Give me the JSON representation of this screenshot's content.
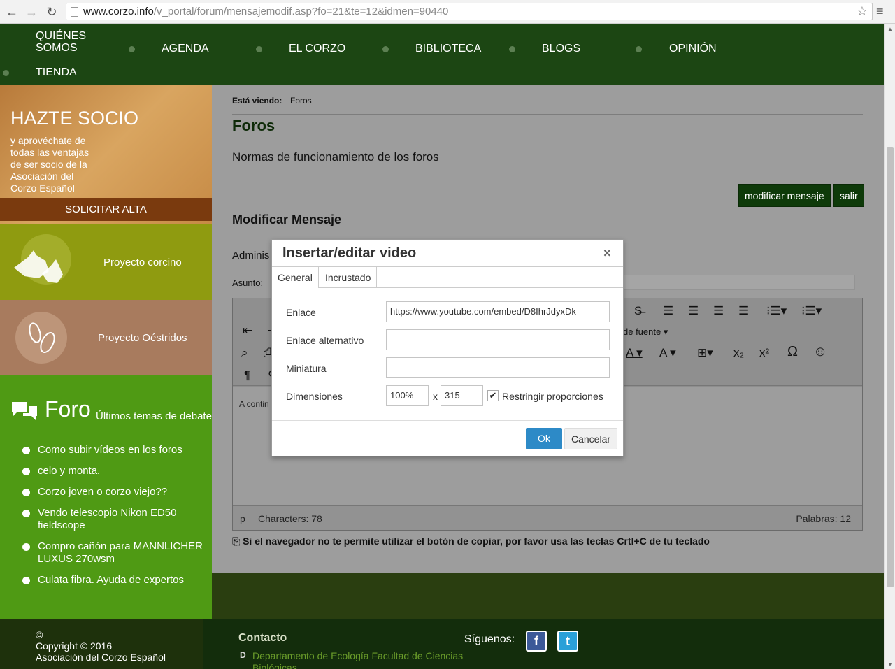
{
  "browser": {
    "url_domain": "www.corzo.info",
    "url_path": "/v_portal/forum/mensajemodif.asp?fo=21&te=12&idmen=90440"
  },
  "nav": {
    "items": [
      "QUIÉNES SOMOS",
      "AGENDA",
      "EL CORZO",
      "BIBLIOTECA",
      "BLOGS",
      "OPINIÓN",
      "TIENDA"
    ],
    "quienes_1": "QUIÉNES",
    "quienes_2": "SOMOS"
  },
  "sidebar": {
    "hazte_title": "HAZTE SOCIO",
    "hazte_text": "y aprovéchate de todas las ventajas de ser socio de la Asociación del Corzo Español",
    "alta_button": "SOLICITAR ALTA",
    "proyecto_corcino": "Proyecto corcino",
    "proyecto_oestridos": "Proyecto Oéstridos",
    "foro_title": "Foro",
    "foro_subtitle": "Últimos temas de debate",
    "foro_topics": [
      "Como subir vídeos en los foros",
      "celo y monta.",
      "Corzo joven o corzo viejo??",
      "Vendo telescopio Nikon ED50 fieldscope",
      "Compro cañón para MANNLICHER LUXUS 270wsm",
      "Culata fibra. Ayuda de expertos"
    ]
  },
  "main": {
    "breadcrumb_label": "Está viendo:",
    "breadcrumb_value": "Foros",
    "title": "Foros",
    "normas": "Normas de funcionamiento de los foros",
    "btn_modificar": "modificar mensaje",
    "btn_salir": "salir",
    "section_title": "Modificar Mensaje",
    "admin_text": "Adminis",
    "asunto_label": "Asunto:",
    "editor_body": "A contin",
    "font_label": "de fuente",
    "status_tag": "p",
    "status_chars": "Characters: 78",
    "status_words": "Palabras: 12",
    "copy_notice": "Si el navegador no te permite utilizar el botón de copiar, por favor usa las teclas Crtl+C de tu teclado"
  },
  "modal": {
    "title": "Insertar/editar video",
    "close": "×",
    "tabs": [
      "General",
      "Incrustado"
    ],
    "label_enlace": "Enlace",
    "value_enlace": "https://www.youtube.com/embed/D8IhrJdyxDk",
    "label_alt": "Enlace alternativo",
    "value_alt": "",
    "label_mini": "Miniatura",
    "value_mini": "",
    "label_dim": "Dimensiones",
    "width": "100%",
    "x_sep": "x",
    "height": "315",
    "constrain_label": "Restringir proporciones",
    "constrain_checked": true,
    "ok": "Ok",
    "cancel": "Cancelar"
  },
  "footer": {
    "copyright_symbol": "©",
    "copyright": "Copyright © 2016",
    "org": "Asociación del Corzo Español",
    "contacto": "Contacto",
    "d_letter": "D",
    "address": "Departamento de Ecología Facultad de Ciencias Biológicas",
    "siguenos": "Síguenos:",
    "facebook": "f",
    "twitter": "t"
  },
  "colors": {
    "nav_bg": "#1c4613",
    "ok_button": "#2d8ac7",
    "foro_bg": "#4f9a14"
  }
}
